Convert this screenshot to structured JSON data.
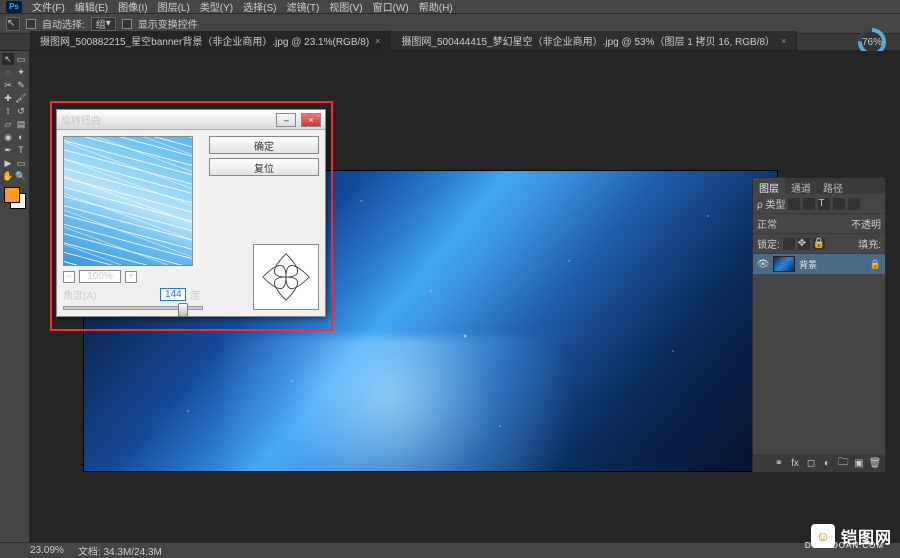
{
  "menu": {
    "items": [
      "文件(F)",
      "编辑(E)",
      "图像(I)",
      "图层(L)",
      "类型(Y)",
      "选择(S)",
      "滤镜(T)",
      "视图(V)",
      "窗口(W)",
      "帮助(H)"
    ]
  },
  "optionbar": {
    "auto_select": "自动选择:",
    "mode": "组",
    "show_transform": "显示变换控件"
  },
  "tabs": [
    {
      "label": "摄图网_500882215_星空banner背景（非企业商用）.jpg @ 23.1%(RGB/8)",
      "active": true
    },
    {
      "label": "摄图网_500444415_梦幻星空（非企业商用）.jpg @ 53%（图层 1 拷贝 16, RGB/8）",
      "active": false
    }
  ],
  "progress": "76%",
  "dialog": {
    "title": "旋转扭曲",
    "ok": "确定",
    "cancel": "复位",
    "zoom": "100%",
    "angle_label": "角度(A)",
    "angle_value": "144",
    "unit": "度"
  },
  "layer_panel": {
    "tabs": [
      "图层",
      "通道",
      "路径"
    ],
    "blend_label": "正常",
    "opacity_label": "不透明",
    "lock_label": "锁定:",
    "fill_label": "填充:",
    "layers": [
      {
        "name": "背景",
        "locked": true
      }
    ]
  },
  "status": {
    "zoom": "23.09%",
    "doc": "文档: 34.3M/24.3M"
  },
  "watermark": {
    "brand": "铠图网",
    "domain": "DOANDOAN.COM"
  }
}
